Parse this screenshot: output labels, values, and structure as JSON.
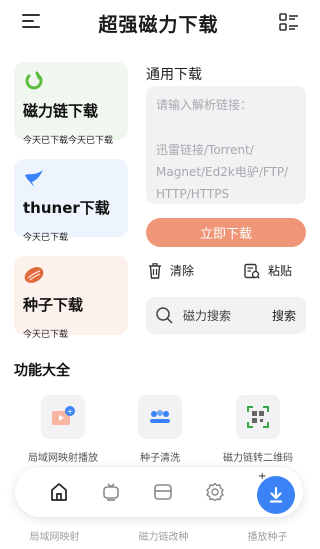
{
  "header": {
    "title": "超强磁力下载"
  },
  "cards": [
    {
      "title": "磁力链下载",
      "subtitle": "今天已下载今天已下载"
    },
    {
      "title": "thuner下载",
      "subtitle": "今天已下载"
    },
    {
      "title": "种子下载",
      "subtitle": "今天已下载"
    }
  ],
  "general": {
    "label": "通用下载",
    "placeholder_line1": "请输入解析链接：",
    "placeholder_line2": "迅雷链接/Torrent/",
    "placeholder_line3": "Magnet/Ed2k电驴/FTP/",
    "placeholder_line4": "HTTP/HTTPS",
    "download_btn": "立即下载",
    "clear_label": "清除",
    "paste_label": "粘贴",
    "search_placeholder": "磁力搜索",
    "search_btn": "搜索"
  },
  "features": {
    "title": "功能大全",
    "items": [
      {
        "label": "局域网映射播放"
      },
      {
        "label": "种子清洗"
      },
      {
        "label": "磁力链转二维码"
      }
    ],
    "next_row": [
      "局域网映射",
      "磁力链改种",
      "播放种子"
    ]
  },
  "colors": {
    "accent_orange": "#ee9677",
    "accent_blue": "#3b82f6",
    "highlight_green": "#7fd66a"
  }
}
